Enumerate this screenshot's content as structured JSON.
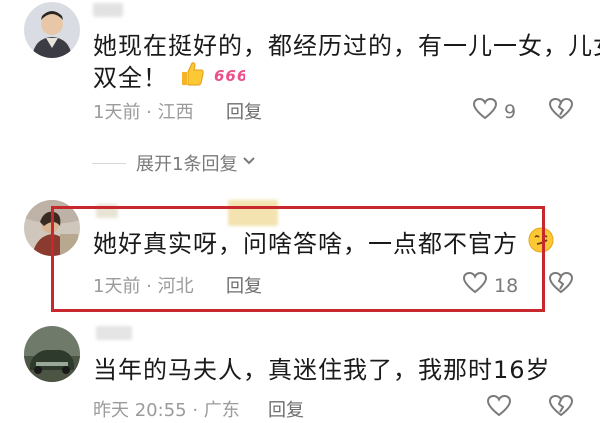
{
  "comments": [
    {
      "text_line1": "她现在挺好的，都经历过的，有一儿一女，儿女",
      "text_line2": "双全！",
      "time": "1天前",
      "location": "江西",
      "reply_label": "回复",
      "likes": "9",
      "emoji": [
        "thumbs-up-emoji",
        "666-sticker"
      ]
    },
    {
      "text": "她好真实呀，问啥答啥，一点都不官方",
      "time": "1天前",
      "location": "河北",
      "reply_label": "回复",
      "likes": "18",
      "emoji": [
        "smirk-emoji"
      ]
    },
    {
      "text": "当年的马夫人，真迷住我了，我那时16岁",
      "time": "昨天 20:55",
      "location": "广东",
      "reply_label": "回复"
    }
  ],
  "expand_replies": {
    "label": "展开1条回复"
  },
  "highlight_color": "#c8272d"
}
